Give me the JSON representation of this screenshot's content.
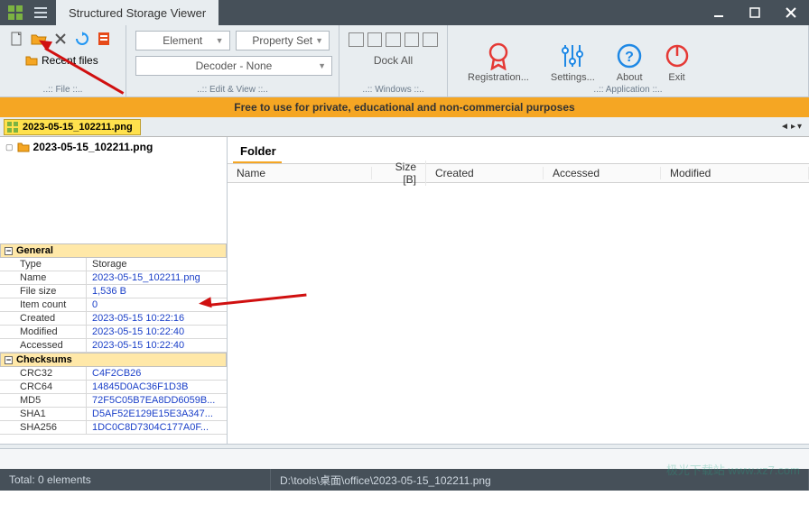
{
  "title": "Structured Storage Viewer",
  "toolbar": {
    "recent": "Recent files",
    "file_label": "..:: File ::..",
    "element": "Element",
    "propertyset": "Property Set",
    "decoder": "Decoder - None",
    "edit_label": "..:: Edit & View ::..",
    "dockall": "Dock All",
    "windows_label": "..:: Windows ::..",
    "registration": "Registration...",
    "settings": "Settings...",
    "about": "About",
    "exit": "Exit",
    "app_label": "..:: Application ::.."
  },
  "banner": "Free to use for private, educational and non-commercial  purposes",
  "tab_file": "2023-05-15_102211.png",
  "tree_root": "2023-05-15_102211.png",
  "panel_title": "Folder",
  "columns": {
    "name": "Name",
    "size": "Size [B]",
    "created": "Created",
    "accessed": "Accessed",
    "modified": "Modified"
  },
  "general": {
    "section": "General",
    "rows": [
      {
        "k": "Type",
        "v": "Storage",
        "plain": true
      },
      {
        "k": "Name",
        "v": "2023-05-15_102211.png"
      },
      {
        "k": "File size",
        "v": "1,536 B"
      },
      {
        "k": "Item count",
        "v": "0"
      },
      {
        "k": "Created",
        "v": "2023-05-15 10:22:16"
      },
      {
        "k": "Modified",
        "v": "2023-05-15 10:22:40"
      },
      {
        "k": "Accessed",
        "v": "2023-05-15 10:22:40"
      }
    ]
  },
  "checksums": {
    "section": "Checksums",
    "rows": [
      {
        "k": "CRC32",
        "v": "C4F2CB26"
      },
      {
        "k": "CRC64",
        "v": "14845D0AC36F1D3B"
      },
      {
        "k": "MD5",
        "v": "72F5C05B7EA8DD6059B..."
      },
      {
        "k": "SHA1",
        "v": "D5AF52E129E15E3A347..."
      },
      {
        "k": "SHA256",
        "v": "1DC0C8D7304C177A0F..."
      }
    ]
  },
  "status": {
    "total": "Total: 0 elements",
    "path": "D:\\tools\\桌面\\office\\2023-05-15_102211.png"
  },
  "watermark": "极光下载站 www.xz7.com"
}
